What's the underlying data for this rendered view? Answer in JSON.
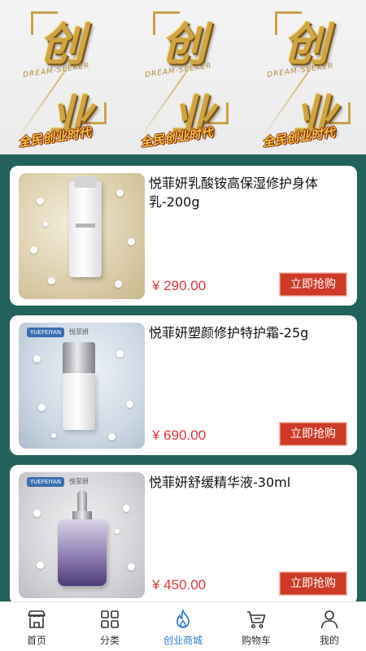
{
  "banner": {
    "tiles": [
      {
        "glyph_top": "创",
        "glyph_bottom": "业",
        "subtitle": "DREAM-SEEKER",
        "slogan": "全民创业时代"
      },
      {
        "glyph_top": "创",
        "glyph_bottom": "业",
        "subtitle": "DREAM-SEEKER",
        "slogan": "全民创业时代"
      },
      {
        "glyph_top": "创",
        "glyph_bottom": "业",
        "subtitle": "DREAM-SEEKER",
        "slogan": "全民创业时代"
      }
    ]
  },
  "products": [
    {
      "title": "悦菲妍乳酸铵高保湿修护身体乳-200g",
      "price": "¥ 290.00",
      "buy_label": "立即抢购",
      "chip": "",
      "brand": ""
    },
    {
      "title": "悦菲妍塑颜修护特护霜-25g",
      "price": "¥ 690.00",
      "buy_label": "立即抢购",
      "chip": "YUEFEIYAN",
      "brand": "悦菲妍"
    },
    {
      "title": "悦菲妍舒缓精华液-30ml",
      "price": "¥ 450.00",
      "buy_label": "立即抢购",
      "chip": "YUEFEIYAN",
      "brand": "悦菲妍"
    }
  ],
  "nav": {
    "items": [
      {
        "label": "首页",
        "icon": "store-icon"
      },
      {
        "label": "分类",
        "icon": "grid-icon"
      },
      {
        "label": "创业商城",
        "icon": "flame-icon"
      },
      {
        "label": "购物车",
        "icon": "cart-icon"
      },
      {
        "label": "我的",
        "icon": "user-icon"
      }
    ],
    "active_index": 2,
    "active_color": "#2f7bd3"
  },
  "colors": {
    "background": "#23625c",
    "buy_button": "#cd3a28",
    "price": "#e0353a"
  }
}
